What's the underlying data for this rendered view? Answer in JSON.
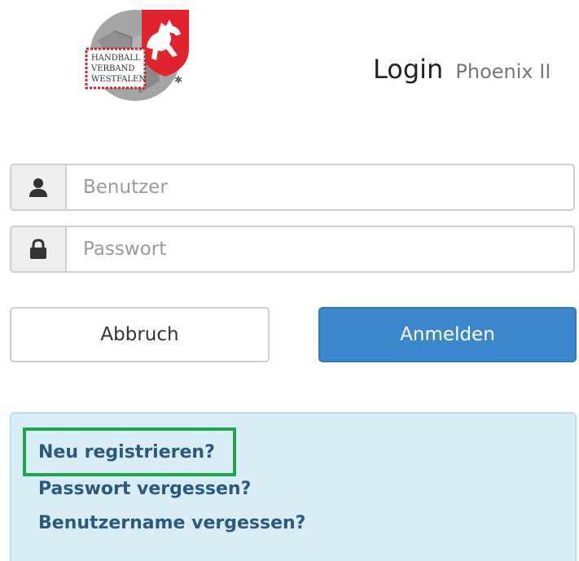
{
  "logo": {
    "lines": [
      "HANDBALL",
      "VERBAND",
      "WESTFALEN"
    ],
    "colors": {
      "ball": "#9c9c9c",
      "shield": "#e0242e",
      "horse": "#ffffff",
      "border_dash": "#d0262d"
    }
  },
  "header": {
    "title": "Login",
    "subtitle": "Phoenix II"
  },
  "form": {
    "username": {
      "placeholder": "Benutzer",
      "value": "",
      "icon": "user-icon"
    },
    "password": {
      "placeholder": "Passwort",
      "value": "",
      "icon": "lock-icon"
    }
  },
  "buttons": {
    "cancel_label": "Abbruch",
    "login_label": "Anmelden",
    "login_color": "#3c87cc"
  },
  "links": {
    "register": "Neu registrieren?",
    "forgot_password": "Passwort vergessen?",
    "forgot_username": "Benutzername vergessen?"
  },
  "colors": {
    "info_background": "#d9edf7",
    "link_color": "#2a5a7c",
    "highlight": "#1fa64a"
  }
}
